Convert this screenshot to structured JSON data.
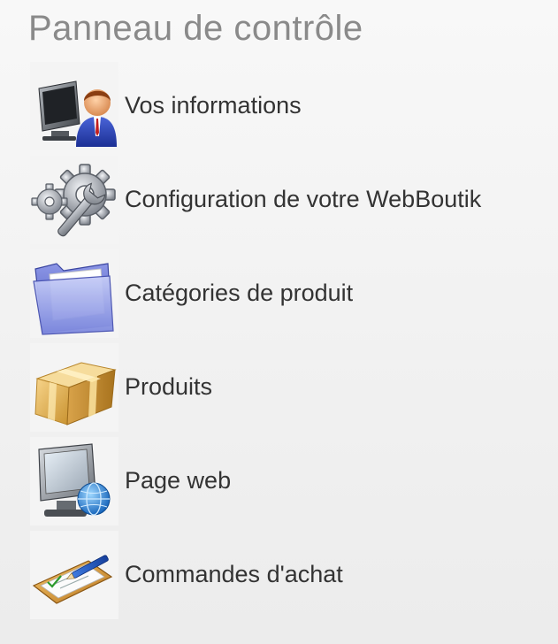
{
  "panel": {
    "title": "Panneau de contrôle",
    "items": [
      {
        "label": "Vos informations",
        "icon": "user-computer-icon"
      },
      {
        "label": "Configuration de votre WebBoutik",
        "icon": "gears-wrench-icon"
      },
      {
        "label": "Catégories de produit",
        "icon": "folder-icon"
      },
      {
        "label": "Produits",
        "icon": "package-box-icon"
      },
      {
        "label": "Page web",
        "icon": "monitor-globe-icon"
      },
      {
        "label": "Commandes d'achat",
        "icon": "clipboard-pen-icon"
      }
    ]
  },
  "colors": {
    "title": "#8a8a8a",
    "label": "#333333",
    "background": "#f2f2f2"
  }
}
